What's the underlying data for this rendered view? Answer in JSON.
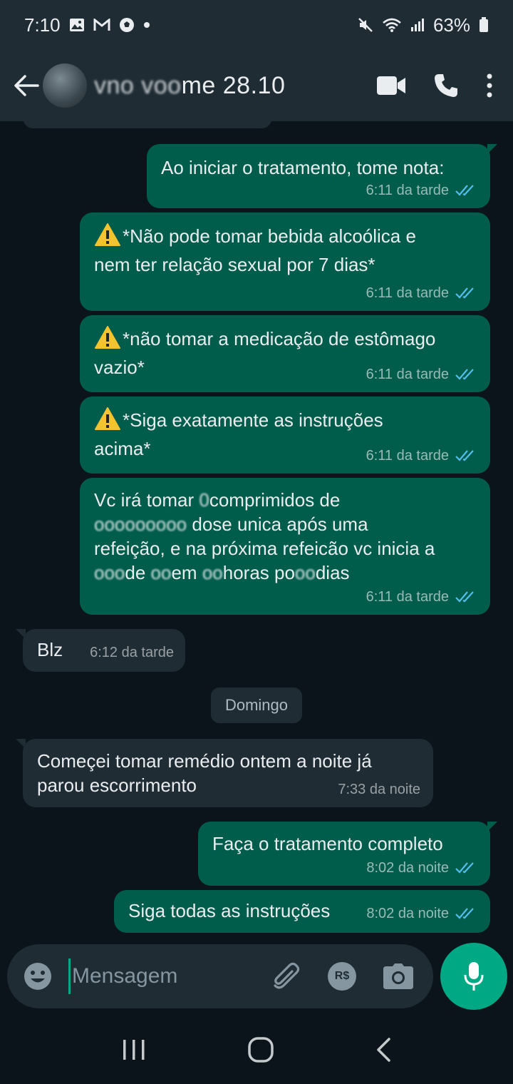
{
  "status_bar": {
    "time": "7:10",
    "battery": "63%"
  },
  "header": {
    "contact_name_obscured": "vno voo",
    "contact_name_visible": "me 28.10",
    "video_icon": "video-call-icon",
    "call_icon": "phone-icon",
    "menu_icon": "more-vertical-icon"
  },
  "messages": [
    {
      "dir": "out",
      "text": "Ao iniciar o tratamento, tome nota:",
      "time": "6:11 da tarde"
    },
    {
      "dir": "out",
      "warn": true,
      "text_line1": "*Não pode tomar bebida alcoólica e",
      "text_line2": "nem ter relação sexual por 7 dias*",
      "time": "6:11 da tarde"
    },
    {
      "dir": "out",
      "warn": true,
      "text_line1": "*não tomar a medicação de estômago",
      "text_line2": "vazio*",
      "time": "6:11 da tarde"
    },
    {
      "dir": "out",
      "warn": true,
      "text_line1": "*Siga exatamente as instruções",
      "text_line2": "acima*",
      "time": "6:11 da tarde"
    },
    {
      "dir": "out",
      "l1a": "Vc irá tomar ",
      "l1b": "0",
      "l1c": "comprimidos  de",
      "l2a": "ooooooooo",
      "l2b": " dose unica após uma",
      "l3": "refeição,  e na próxima refeicão vc inicia a",
      "l4a": "ooo",
      "l4b": "de ",
      "l4c": "oo",
      "l4d": "em ",
      "l4e": "oo",
      "l4f": "horas po",
      "l4g": "oo",
      "l4h": "dias",
      "time": "6:11 da tarde"
    },
    {
      "dir": "in",
      "text": "Blz",
      "time": "6:12 da tarde"
    },
    {
      "dir": "in",
      "text_line1": "Começei tomar remédio ontem a noite já",
      "text_line2": "parou escorrimento",
      "time": "7:33 da noite"
    },
    {
      "dir": "out",
      "text": "Faça o tratamento  completo",
      "time": "8:02 da noite"
    },
    {
      "dir": "out",
      "text": "Siga todas as instruções",
      "time": "8:02 da noite"
    }
  ],
  "date_separator": "Domingo",
  "composer": {
    "placeholder": "Mensagem",
    "emoji_icon": "emoji-icon",
    "attach_icon": "paperclip-icon",
    "payment_icon": "rs-payment-icon",
    "payment_label": "R$",
    "camera_icon": "camera-icon",
    "mic_icon": "microphone-icon"
  },
  "colors": {
    "outgoing_bubble": "#005c4b",
    "incoming_bubble": "#1f2c34",
    "accent": "#00a884",
    "read_ticks": "#53bdeb"
  }
}
